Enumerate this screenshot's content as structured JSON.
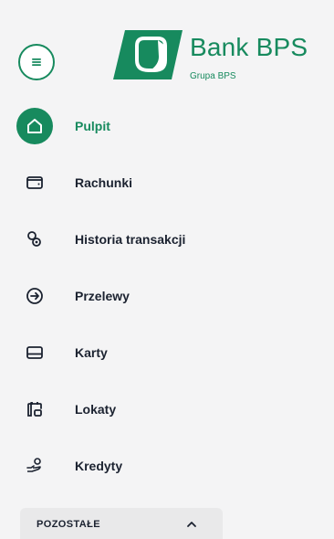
{
  "brand": {
    "name": "Bank BPS",
    "subtitle": "Grupa BPS",
    "color": "#178a5e"
  },
  "menu_toggle": {
    "icon": "hamburger-icon"
  },
  "nav": {
    "active": "Pulpit",
    "items": [
      {
        "label": "Pulpit",
        "icon": "home-icon"
      },
      {
        "label": "Rachunki",
        "icon": "wallet-icon"
      },
      {
        "label": "Historia transakcji",
        "icon": "history-icon"
      },
      {
        "label": "Przelewy",
        "icon": "transfer-icon"
      },
      {
        "label": "Karty",
        "icon": "card-icon"
      },
      {
        "label": "Lokaty",
        "icon": "deposit-icon"
      },
      {
        "label": "Kredyty",
        "icon": "loan-icon"
      }
    ]
  },
  "other": {
    "label": "POZOSTAŁE",
    "expanded_icon": "chevron-up-icon"
  }
}
